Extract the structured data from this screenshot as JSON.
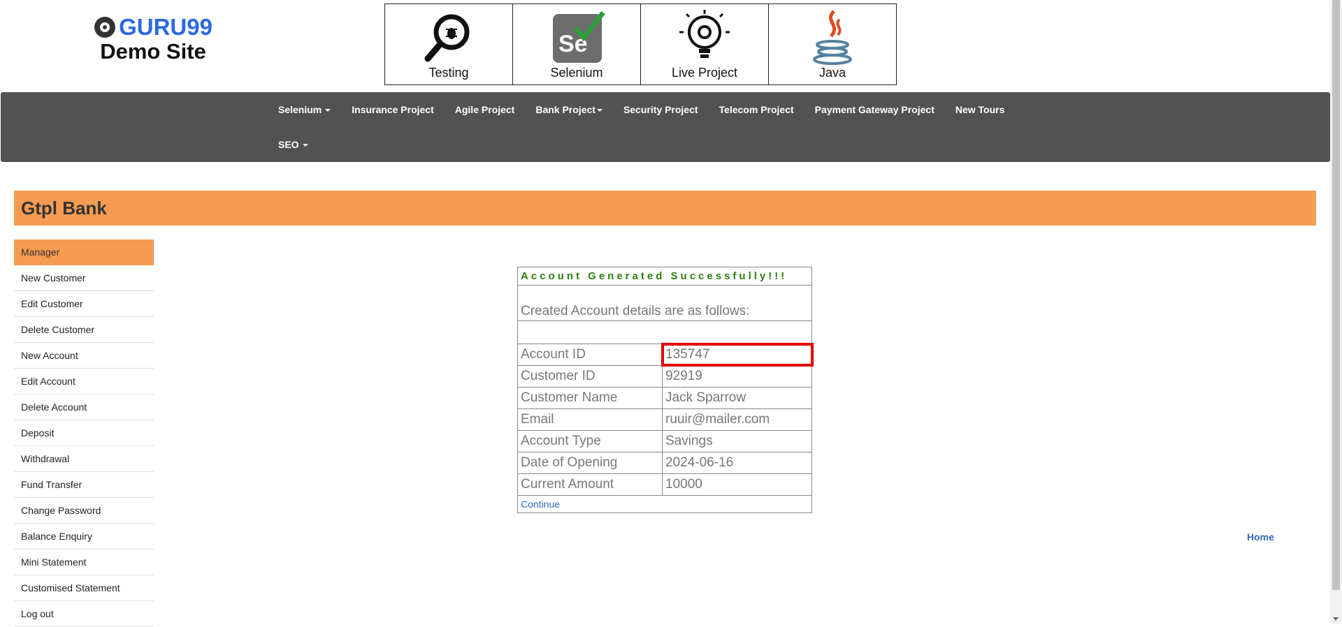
{
  "header": {
    "logo_brand": "GURU99",
    "logo_subtitle": "Demo Site",
    "tiles": [
      {
        "label": "Testing",
        "icon": "magnifier-bug-icon"
      },
      {
        "label": "Selenium",
        "icon": "selenium-icon"
      },
      {
        "label": "Live Project",
        "icon": "gear-bulb-icon"
      },
      {
        "label": "Java",
        "icon": "java-icon"
      }
    ]
  },
  "navbar": {
    "row1": [
      {
        "label": "Selenium",
        "dropdown": true
      },
      {
        "label": "Insurance Project",
        "dropdown": false
      },
      {
        "label": "Agile Project",
        "dropdown": false
      },
      {
        "label": "Bank Project",
        "dropdown": true
      },
      {
        "label": "Security Project",
        "dropdown": false
      },
      {
        "label": "Telecom Project",
        "dropdown": false
      },
      {
        "label": "Payment Gateway Project",
        "dropdown": false
      },
      {
        "label": "New Tours",
        "dropdown": false
      }
    ],
    "row2": [
      {
        "label": "SEO",
        "dropdown": true
      }
    ]
  },
  "banner": {
    "title": "Gtpl Bank"
  },
  "sidebar": {
    "items": [
      "Manager",
      "New Customer",
      "Edit Customer",
      "Delete Customer",
      "New Account",
      "Edit Account",
      "Delete Account",
      "Deposit",
      "Withdrawal",
      "Fund Transfer",
      "Change Password",
      "Balance Enquiry",
      "Mini Statement",
      "Customised Statement",
      "Log out"
    ]
  },
  "result": {
    "success_message": "Account Generated Successfully!!!",
    "intro": "Created Account details are as follows:",
    "rows": [
      {
        "label": "Account ID",
        "value": "135747"
      },
      {
        "label": "Customer ID",
        "value": "92919"
      },
      {
        "label": "Customer Name",
        "value": "Jack Sparrow"
      },
      {
        "label": "Email",
        "value": "ruuir@mailer.com"
      },
      {
        "label": "Account Type",
        "value": "Savings"
      },
      {
        "label": "Date of Opening",
        "value": "2024-06-16"
      },
      {
        "label": "Current Amount",
        "value": "10000"
      }
    ],
    "continue_label": "Continue"
  },
  "home_link": "Home",
  "colors": {
    "accent": "#f79b51",
    "navbar": "#525252",
    "brand_blue": "#2b69e3",
    "success_green": "#2e7d0f",
    "highlight_red": "#e60000",
    "link": "#2f6ab7"
  }
}
